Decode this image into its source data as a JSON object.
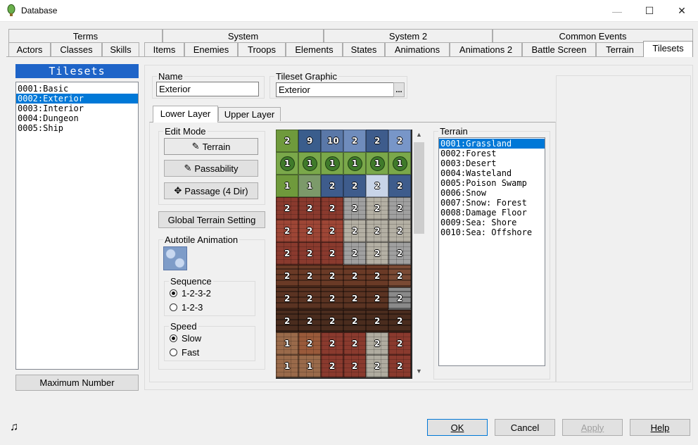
{
  "window": {
    "title": "Database",
    "minimize": "—",
    "maximize": "☐",
    "close": "✕"
  },
  "tabs_row1": [
    "Terms",
    "System",
    "System 2",
    "Common Events"
  ],
  "tabs_row2": [
    "Actors",
    "Classes",
    "Skills",
    "Items",
    "Enemies",
    "Troops",
    "Elements",
    "States",
    "Animations",
    "Animations 2",
    "Battle Screen",
    "Terrain",
    "Tilesets"
  ],
  "active_tab": "Tilesets",
  "tilesets": {
    "header": "Tilesets",
    "items": [
      "0001:Basic",
      "0002:Exterior",
      "0003:Interior",
      "0004:Dungeon",
      "0005:Ship"
    ],
    "selected_index": 1,
    "max_button": "Maximum Number"
  },
  "name_field": {
    "label": "Name",
    "value": "Exterior"
  },
  "graphic_field": {
    "label": "Tileset Graphic",
    "value": "Exterior",
    "browse": "..."
  },
  "layer_tabs": {
    "lower": "Lower Layer",
    "upper": "Upper Layer"
  },
  "edit_mode": {
    "label": "Edit Mode",
    "terrain": "Terrain",
    "passability": "Passability",
    "passage": "Passage (4 Dir)"
  },
  "global_terrain_button": "Global Terrain Setting",
  "autotile": {
    "label": "Autotile Animation",
    "sequence_label": "Sequence",
    "seq_opt1": "1-2-3-2",
    "seq_opt2": "1-2-3",
    "speed_label": "Speed",
    "speed_opt1": "Slow",
    "speed_opt2": "Fast"
  },
  "terrain": {
    "label": "Terrain",
    "items": [
      "0001:Grassland",
      "0002:Forest",
      "0003:Desert",
      "0004:Wasteland",
      "0005:Poison Swamp",
      "0006:Snow",
      "0007:Snow: Forest",
      "0008:Damage Floor",
      "0009:Sea: Shore",
      "0010:Sea: Offshore"
    ],
    "selected_index": 0
  },
  "tile_rows": [
    [
      "2",
      "9",
      "10",
      "2",
      "2",
      "2"
    ],
    [
      "1",
      "1",
      "1",
      "1",
      "1",
      "1"
    ],
    [
      "1",
      "1",
      "2",
      "2",
      "2",
      "2"
    ],
    [
      "2",
      "2",
      "2",
      "2",
      "2",
      "2"
    ],
    [
      "2",
      "2",
      "2",
      "2",
      "2",
      "2"
    ],
    [
      "2",
      "2",
      "2",
      "2",
      "2",
      "2"
    ],
    [
      "2",
      "2",
      "2",
      "2",
      "2",
      "2"
    ],
    [
      "2",
      "2",
      "2",
      "2",
      "2",
      "2"
    ],
    [
      "2",
      "2",
      "2",
      "2",
      "2",
      "2"
    ],
    [
      "1",
      "2",
      "2",
      "2",
      "2",
      "2"
    ],
    [
      "1",
      "1",
      "2",
      "2",
      "2",
      "2"
    ]
  ],
  "footer": {
    "ok": "OK",
    "cancel": "Cancel",
    "apply": "Apply",
    "help": "Help"
  },
  "icons": [
    "app-icon",
    "music-icon",
    "terrain-icon",
    "passability-icon",
    "passage-icon"
  ],
  "colors": {
    "selection": "#0078d7",
    "tileset_header": "#1e64c8"
  }
}
